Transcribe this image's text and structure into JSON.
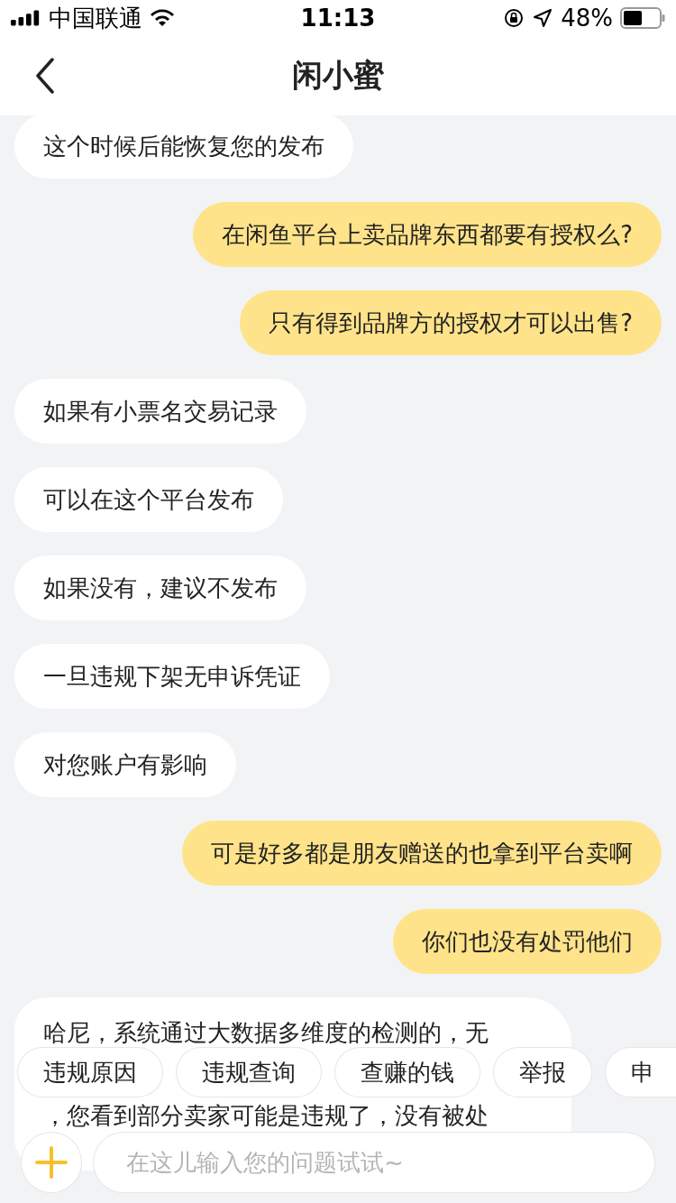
{
  "status_bar": {
    "carrier": "中国联通",
    "time": "11:13",
    "battery": "48%"
  },
  "nav": {
    "title": "闲小蜜"
  },
  "messages": [
    {
      "kind": "received",
      "lines": [
        "这个时候后能恢复您的发布"
      ]
    },
    {
      "kind": "sent",
      "lines": [
        "在闲鱼平台上卖品牌东西都要有授权么?"
      ]
    },
    {
      "kind": "sent",
      "lines": [
        "只有得到品牌方的授权才可以出售?"
      ]
    },
    {
      "kind": "received",
      "lines": [
        "如果有小票名交易记录"
      ]
    },
    {
      "kind": "received",
      "lines": [
        "可以在这个平台发布"
      ]
    },
    {
      "kind": "received",
      "lines": [
        "如果没有，建议不发布"
      ]
    },
    {
      "kind": "received",
      "lines": [
        "一旦违规下架无申诉凭证"
      ]
    },
    {
      "kind": "received",
      "lines": [
        "对您账户有影响"
      ]
    },
    {
      "kind": "sent",
      "lines": [
        "可是好多都是朋友赠送的也拿到平台卖啊"
      ]
    },
    {
      "kind": "sent",
      "lines": [
        "你们也没有处罚他们"
      ]
    },
    {
      "kind": "received",
      "lines": [
        "哈尼，系统通过大数据多维度的检测的，无",
        "，您看到部分卖家可能是违规了，没有被处"
      ]
    }
  ],
  "quick_replies": [
    "违规原因",
    "违规查询",
    "查赚的钱",
    "举报",
    "申"
  ],
  "input": {
    "placeholder": "在这儿输入您的问题试试~"
  }
}
